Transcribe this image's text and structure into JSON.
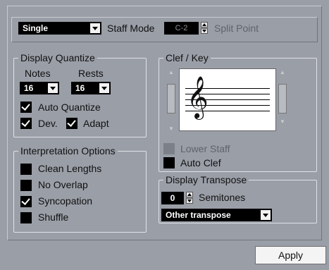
{
  "top": {
    "mode_value": "Single",
    "staff_mode_label": "Staff Mode",
    "split_value": "C-2",
    "split_point_label": "Split Point"
  },
  "display_quantize": {
    "title": "Display Quantize",
    "notes_label": "Notes",
    "rests_label": "Rests",
    "notes_value": "16",
    "rests_value": "16",
    "auto_quantize_label": "Auto Quantize",
    "auto_quantize_checked": true,
    "dev_label": "Dev.",
    "dev_checked": true,
    "adapt_label": "Adapt",
    "adapt_checked": true
  },
  "interpretation": {
    "title": "Interpretation Options",
    "items": [
      {
        "label": "Clean Lengths",
        "checked": false
      },
      {
        "label": "No Overlap",
        "checked": false
      },
      {
        "label": "Syncopation",
        "checked": true
      },
      {
        "label": "Shuffle",
        "checked": false
      }
    ]
  },
  "clef_key": {
    "title": "Clef / Key",
    "clef_symbol": "𝄞",
    "lower_staff_label": "Lower Staff",
    "lower_staff_checked": false,
    "auto_clef_label": "Auto Clef",
    "auto_clef_checked": false
  },
  "display_transpose": {
    "title": "Display Transpose",
    "semitones_value": "0",
    "semitones_label": "Semitones",
    "transpose_value": "Other transpose"
  },
  "apply_label": "Apply",
  "colors": {
    "background": "#9a9ea7",
    "control_dark": "#000000",
    "group_border": "#dfe1e6"
  }
}
